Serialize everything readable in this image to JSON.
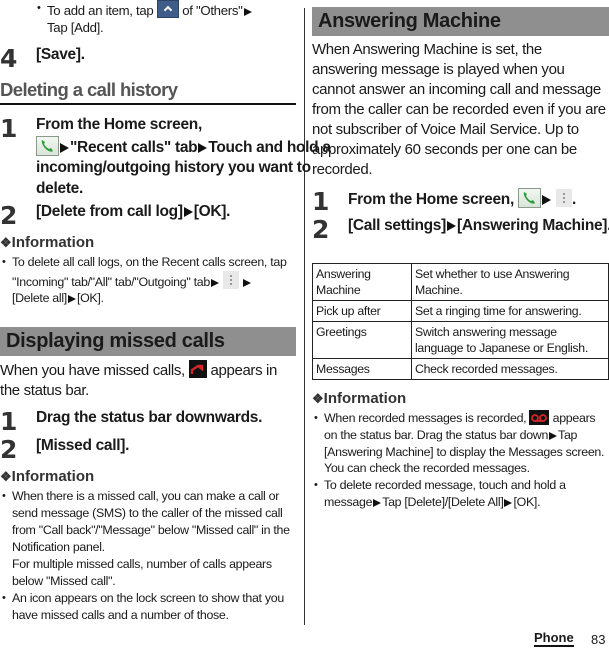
{
  "left": {
    "top_bullet": {
      "pre": "To add an item, tap",
      "icon": "chevron-up-icon",
      "post": "of \"Others\"",
      "line2": "Tap [Add]."
    },
    "step4": {
      "num": "4",
      "text": "[Save]."
    },
    "deleting": {
      "heading": "Deleting a call history",
      "step1": {
        "num": "1",
        "line1": "From the Home screen,",
        "icon": "phone-icon",
        "part2": "\"Recent calls\" tab",
        "part3": "Touch and hold a incoming/outgoing history you want to delete."
      },
      "step2": {
        "num": "2",
        "part1": "[Delete from call log]",
        "part2": "[OK]."
      },
      "info": {
        "heading": "Information",
        "bullet": {
          "pre": "To delete all call logs, on the Recent calls screen, tap \"Incoming\" tab/\"All\" tab/\"Outgoing\" tab",
          "icon": "menu-icon",
          "post1": "[Delete all]",
          "post2": "[OK]."
        }
      }
    },
    "missed": {
      "heading": "Displaying missed calls",
      "intro_pre": "When you have missed calls,",
      "intro_icon": "missed-call-icon",
      "intro_post": "appears in the status bar.",
      "step1": {
        "num": "1",
        "text": "Drag the status bar downwards."
      },
      "step2": {
        "num": "2",
        "text": "[Missed call]."
      },
      "info": {
        "heading": "Information",
        "bullet1_a": "When there is a missed call, you can make a call or send message (SMS) to the caller of the missed call from \"Call back\"/\"Message\" below \"Missed call\" in the Notification panel.",
        "bullet1_b": "For multiple missed calls, number of calls appears below \"Missed call\".",
        "bullet2": "An icon appears on the lock screen to show that you have missed calls and a number of those."
      }
    }
  },
  "right": {
    "heading": "Answering Machine",
    "intro": "When Answering Machine is set, the answering message is played when you cannot answer an incoming call and message from the caller can be recorded even if you are not subscriber of Voice Mail Service. Up to approximately 60 seconds per one can be recorded.",
    "step1": {
      "num": "1",
      "text": "From the Home screen,",
      "icon1": "phone-icon",
      "icon2": "menu-icon",
      "end": "."
    },
    "step2": {
      "num": "2",
      "part1": "[Call settings]",
      "part2": "[Answering Machine]."
    },
    "table": [
      {
        "key": "Answering Machine",
        "value": "Set whether to use Answering Machine."
      },
      {
        "key": "Pick up after",
        "value": "Set a ringing time for answering."
      },
      {
        "key": "Greetings",
        "value": "Switch answering message language to Japanese or English."
      },
      {
        "key": "Messages",
        "value": "Check recorded messages."
      }
    ],
    "info": {
      "heading": "Information",
      "bullet1_pre": "When recorded messages is recorded,",
      "bullet1_icon": "voicemail-icon",
      "bullet1_mid": "appears on the status bar. Drag the status bar down",
      "bullet1_post": "Tap [Answering Machine] to display the Messages screen. You can check the recorded messages.",
      "bullet2_pre": "To delete recorded message, touch and hold a message",
      "bullet2_mid": "Tap [Delete]/[Delete All]",
      "bullet2_post": "[OK]."
    }
  },
  "footer": {
    "section": "Phone",
    "page": "83"
  },
  "colors": {
    "band": "#8f8f8f",
    "subhead": "#555555",
    "phone_green": "#2e9e3a",
    "missed_red": "#d0262b",
    "icon_blue": "#3e5d88"
  }
}
